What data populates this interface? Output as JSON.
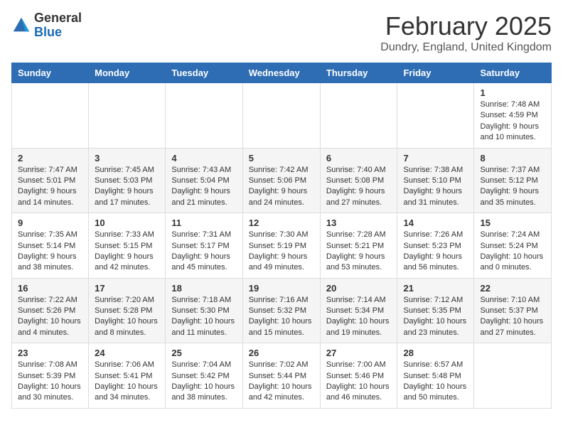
{
  "logo": {
    "general": "General",
    "blue": "Blue"
  },
  "header": {
    "month": "February 2025",
    "location": "Dundry, England, United Kingdom"
  },
  "days_of_week": [
    "Sunday",
    "Monday",
    "Tuesday",
    "Wednesday",
    "Thursday",
    "Friday",
    "Saturday"
  ],
  "weeks": [
    [
      {
        "day": "",
        "sunrise": "",
        "sunset": "",
        "daylight": ""
      },
      {
        "day": "",
        "sunrise": "",
        "sunset": "",
        "daylight": ""
      },
      {
        "day": "",
        "sunrise": "",
        "sunset": "",
        "daylight": ""
      },
      {
        "day": "",
        "sunrise": "",
        "sunset": "",
        "daylight": ""
      },
      {
        "day": "",
        "sunrise": "",
        "sunset": "",
        "daylight": ""
      },
      {
        "day": "",
        "sunrise": "",
        "sunset": "",
        "daylight": ""
      },
      {
        "day": "1",
        "sunrise": "Sunrise: 7:48 AM",
        "sunset": "Sunset: 4:59 PM",
        "daylight": "Daylight: 9 hours and 10 minutes."
      }
    ],
    [
      {
        "day": "2",
        "sunrise": "Sunrise: 7:47 AM",
        "sunset": "Sunset: 5:01 PM",
        "daylight": "Daylight: 9 hours and 14 minutes."
      },
      {
        "day": "3",
        "sunrise": "Sunrise: 7:45 AM",
        "sunset": "Sunset: 5:03 PM",
        "daylight": "Daylight: 9 hours and 17 minutes."
      },
      {
        "day": "4",
        "sunrise": "Sunrise: 7:43 AM",
        "sunset": "Sunset: 5:04 PM",
        "daylight": "Daylight: 9 hours and 21 minutes."
      },
      {
        "day": "5",
        "sunrise": "Sunrise: 7:42 AM",
        "sunset": "Sunset: 5:06 PM",
        "daylight": "Daylight: 9 hours and 24 minutes."
      },
      {
        "day": "6",
        "sunrise": "Sunrise: 7:40 AM",
        "sunset": "Sunset: 5:08 PM",
        "daylight": "Daylight: 9 hours and 27 minutes."
      },
      {
        "day": "7",
        "sunrise": "Sunrise: 7:38 AM",
        "sunset": "Sunset: 5:10 PM",
        "daylight": "Daylight: 9 hours and 31 minutes."
      },
      {
        "day": "8",
        "sunrise": "Sunrise: 7:37 AM",
        "sunset": "Sunset: 5:12 PM",
        "daylight": "Daylight: 9 hours and 35 minutes."
      }
    ],
    [
      {
        "day": "9",
        "sunrise": "Sunrise: 7:35 AM",
        "sunset": "Sunset: 5:14 PM",
        "daylight": "Daylight: 9 hours and 38 minutes."
      },
      {
        "day": "10",
        "sunrise": "Sunrise: 7:33 AM",
        "sunset": "Sunset: 5:15 PM",
        "daylight": "Daylight: 9 hours and 42 minutes."
      },
      {
        "day": "11",
        "sunrise": "Sunrise: 7:31 AM",
        "sunset": "Sunset: 5:17 PM",
        "daylight": "Daylight: 9 hours and 45 minutes."
      },
      {
        "day": "12",
        "sunrise": "Sunrise: 7:30 AM",
        "sunset": "Sunset: 5:19 PM",
        "daylight": "Daylight: 9 hours and 49 minutes."
      },
      {
        "day": "13",
        "sunrise": "Sunrise: 7:28 AM",
        "sunset": "Sunset: 5:21 PM",
        "daylight": "Daylight: 9 hours and 53 minutes."
      },
      {
        "day": "14",
        "sunrise": "Sunrise: 7:26 AM",
        "sunset": "Sunset: 5:23 PM",
        "daylight": "Daylight: 9 hours and 56 minutes."
      },
      {
        "day": "15",
        "sunrise": "Sunrise: 7:24 AM",
        "sunset": "Sunset: 5:24 PM",
        "daylight": "Daylight: 10 hours and 0 minutes."
      }
    ],
    [
      {
        "day": "16",
        "sunrise": "Sunrise: 7:22 AM",
        "sunset": "Sunset: 5:26 PM",
        "daylight": "Daylight: 10 hours and 4 minutes."
      },
      {
        "day": "17",
        "sunrise": "Sunrise: 7:20 AM",
        "sunset": "Sunset: 5:28 PM",
        "daylight": "Daylight: 10 hours and 8 minutes."
      },
      {
        "day": "18",
        "sunrise": "Sunrise: 7:18 AM",
        "sunset": "Sunset: 5:30 PM",
        "daylight": "Daylight: 10 hours and 11 minutes."
      },
      {
        "day": "19",
        "sunrise": "Sunrise: 7:16 AM",
        "sunset": "Sunset: 5:32 PM",
        "daylight": "Daylight: 10 hours and 15 minutes."
      },
      {
        "day": "20",
        "sunrise": "Sunrise: 7:14 AM",
        "sunset": "Sunset: 5:34 PM",
        "daylight": "Daylight: 10 hours and 19 minutes."
      },
      {
        "day": "21",
        "sunrise": "Sunrise: 7:12 AM",
        "sunset": "Sunset: 5:35 PM",
        "daylight": "Daylight: 10 hours and 23 minutes."
      },
      {
        "day": "22",
        "sunrise": "Sunrise: 7:10 AM",
        "sunset": "Sunset: 5:37 PM",
        "daylight": "Daylight: 10 hours and 27 minutes."
      }
    ],
    [
      {
        "day": "23",
        "sunrise": "Sunrise: 7:08 AM",
        "sunset": "Sunset: 5:39 PM",
        "daylight": "Daylight: 10 hours and 30 minutes."
      },
      {
        "day": "24",
        "sunrise": "Sunrise: 7:06 AM",
        "sunset": "Sunset: 5:41 PM",
        "daylight": "Daylight: 10 hours and 34 minutes."
      },
      {
        "day": "25",
        "sunrise": "Sunrise: 7:04 AM",
        "sunset": "Sunset: 5:42 PM",
        "daylight": "Daylight: 10 hours and 38 minutes."
      },
      {
        "day": "26",
        "sunrise": "Sunrise: 7:02 AM",
        "sunset": "Sunset: 5:44 PM",
        "daylight": "Daylight: 10 hours and 42 minutes."
      },
      {
        "day": "27",
        "sunrise": "Sunrise: 7:00 AM",
        "sunset": "Sunset: 5:46 PM",
        "daylight": "Daylight: 10 hours and 46 minutes."
      },
      {
        "day": "28",
        "sunrise": "Sunrise: 6:57 AM",
        "sunset": "Sunset: 5:48 PM",
        "daylight": "Daylight: 10 hours and 50 minutes."
      },
      {
        "day": "",
        "sunrise": "",
        "sunset": "",
        "daylight": ""
      }
    ]
  ]
}
